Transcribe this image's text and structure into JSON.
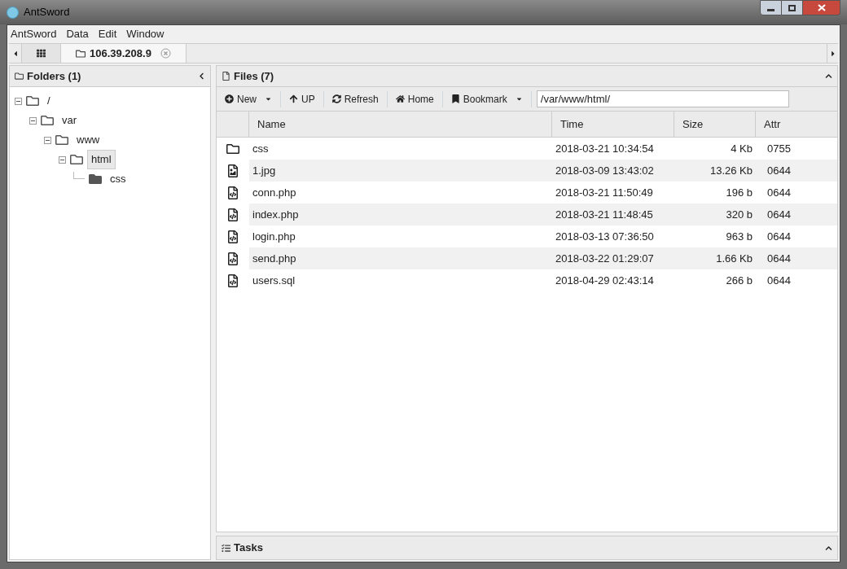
{
  "window": {
    "title": "AntSword"
  },
  "menu": [
    "AntSword",
    "Data",
    "Edit",
    "Window"
  ],
  "tabs": [
    {
      "kind": "grid",
      "selected": false
    },
    {
      "kind": "folder",
      "label": "106.39.208.9",
      "selected": true
    }
  ],
  "folders_panel": {
    "title": "Folders (1)",
    "tree": [
      {
        "name": "/",
        "expanded": true,
        "selected": false,
        "children": [
          {
            "name": "var",
            "expanded": true,
            "selected": false,
            "children": [
              {
                "name": "www",
                "expanded": true,
                "selected": false,
                "children": [
                  {
                    "name": "html",
                    "expanded": true,
                    "selected": true,
                    "children": [
                      {
                        "name": "css",
                        "expanded": false,
                        "selected": false
                      }
                    ]
                  }
                ]
              }
            ]
          }
        ]
      }
    ]
  },
  "files_panel": {
    "title": "Files (7)",
    "toolbar": [
      {
        "kind": "new",
        "label": "New",
        "dropdown": true
      },
      {
        "kind": "up",
        "label": "UP",
        "dropdown": false
      },
      {
        "kind": "refresh",
        "label": "Refresh",
        "dropdown": false
      },
      {
        "kind": "home",
        "label": "Home",
        "dropdown": false
      },
      {
        "kind": "bookmark",
        "label": "Bookmark",
        "dropdown": true
      }
    ],
    "path": "/var/www/html/",
    "columns": [
      "Name",
      "Time",
      "Size",
      "Attr"
    ],
    "rows": [
      {
        "kind": "folder",
        "name": "css",
        "time": "2018-03-21 10:34:54",
        "size": "4 Kb",
        "attr": "0755"
      },
      {
        "kind": "image",
        "name": "1.jpg",
        "time": "2018-03-09 13:43:02",
        "size": "13.26 Kb",
        "attr": "0644"
      },
      {
        "kind": "code",
        "name": "conn.php",
        "time": "2018-03-21 11:50:49",
        "size": "196 b",
        "attr": "0644"
      },
      {
        "kind": "code",
        "name": "index.php",
        "time": "2018-03-21 11:48:45",
        "size": "320 b",
        "attr": "0644"
      },
      {
        "kind": "code",
        "name": "login.php",
        "time": "2018-03-13 07:36:50",
        "size": "963 b",
        "attr": "0644"
      },
      {
        "kind": "code",
        "name": "send.php",
        "time": "2018-03-22 01:29:07",
        "size": "1.66 Kb",
        "attr": "0644"
      },
      {
        "kind": "code",
        "name": "users.sql",
        "time": "2018-04-29 02:43:14",
        "size": "266 b",
        "attr": "0644"
      }
    ]
  },
  "tasks_panel": {
    "title": "Tasks"
  }
}
